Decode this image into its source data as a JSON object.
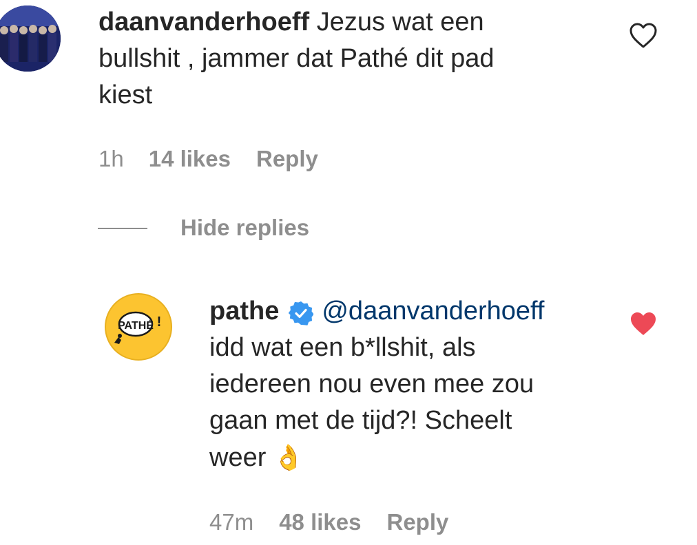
{
  "comments": [
    {
      "username": "daanvanderhoeff",
      "text_line1": " Jezus wat een",
      "text_line2": "bullshit , jammer dat Pathé dit pad",
      "text_line3": "kiest",
      "time": "1h",
      "likes": "14 likes",
      "reply_label": "Reply",
      "liked": false
    }
  ],
  "hide_replies_label": "Hide replies",
  "reply": {
    "username": "pathe",
    "verified": true,
    "avatar_text": "PATHÉ!",
    "mention": "@daanvanderhoeff",
    "text_line1": "idd wat een b*llshit, als",
    "text_line2": "iedereen nou even mee zou",
    "text_line3": "gaan met de tijd?! Scheelt",
    "text_line4": "weer ",
    "emoji": "👌",
    "time": "47m",
    "likes": "48 likes",
    "reply_label": "Reply",
    "liked": true
  },
  "colors": {
    "heart_liked": "#ed4956",
    "verified": "#3897f0",
    "mention": "#00376b",
    "pathe_yellow": "#fcc430"
  }
}
